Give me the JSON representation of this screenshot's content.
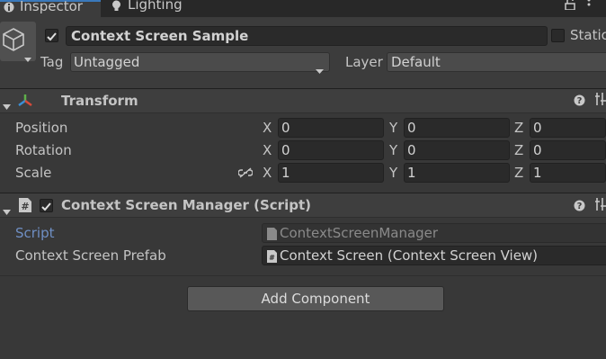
{
  "tabs": [
    {
      "label": "Inspector",
      "icon": "info-icon"
    },
    {
      "label": "Lighting",
      "icon": "lightbulb-icon"
    }
  ],
  "object": {
    "active": true,
    "name": "Context Screen Sample",
    "static_label": "Static",
    "tag_label": "Tag",
    "tag_value": "Untagged",
    "layer_label": "Layer",
    "layer_value": "Default"
  },
  "transform": {
    "title": "Transform",
    "rows": [
      {
        "label": "Position",
        "x": "0",
        "y": "0",
        "z": "0"
      },
      {
        "label": "Rotation",
        "x": "0",
        "y": "0",
        "z": "0"
      },
      {
        "label": "Scale",
        "x": "1",
        "y": "1",
        "z": "1"
      }
    ],
    "axes": {
      "x": "X",
      "y": "Y",
      "z": "Z"
    }
  },
  "script_component": {
    "title": "Context Screen Manager (Script)",
    "enabled": true,
    "script_label": "Script",
    "script_value": "ContextScreenManager",
    "prefab_label": "Context Screen Prefab",
    "prefab_value": "Context Screen (Context Screen View)"
  },
  "add_component_label": "Add Component",
  "colors": {
    "accent": "#3a79bb",
    "script_label": "#6f8fc4"
  }
}
